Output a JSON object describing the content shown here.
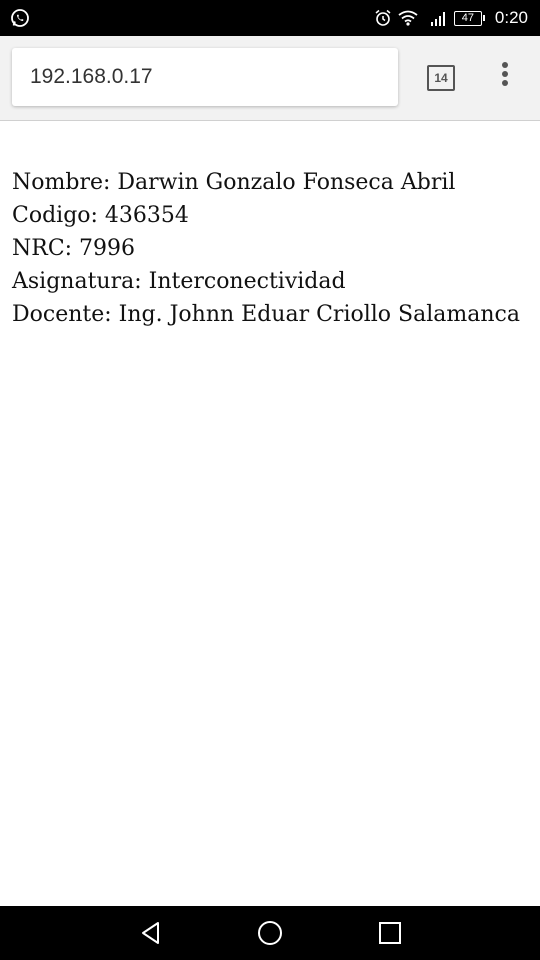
{
  "status_bar": {
    "left_icon": "whatsapp-icon",
    "icons": [
      "alarm-icon",
      "wifi-icon",
      "signal-icon",
      "battery-icon"
    ],
    "battery_level": "47",
    "time": "0:20"
  },
  "browser": {
    "url": "192.168.0.17",
    "tab_count": "14",
    "menu_icon": "overflow-menu-icon"
  },
  "page": {
    "lines": [
      "Nombre: Darwin Gonzalo Fonseca Abril",
      "Codigo: 436354",
      "NRC: 7996",
      "Asignatura: Interconectividad",
      "Docente: Ing. Johnn Eduar Criollo Salamanca"
    ]
  },
  "nav_bar": {
    "buttons": [
      "back-icon",
      "home-icon",
      "recents-icon"
    ]
  },
  "colors": {
    "status_bar_bg": "#000000",
    "toolbar_bg": "#f2f2f2",
    "page_bg": "#ffffff",
    "text": "#111111"
  }
}
